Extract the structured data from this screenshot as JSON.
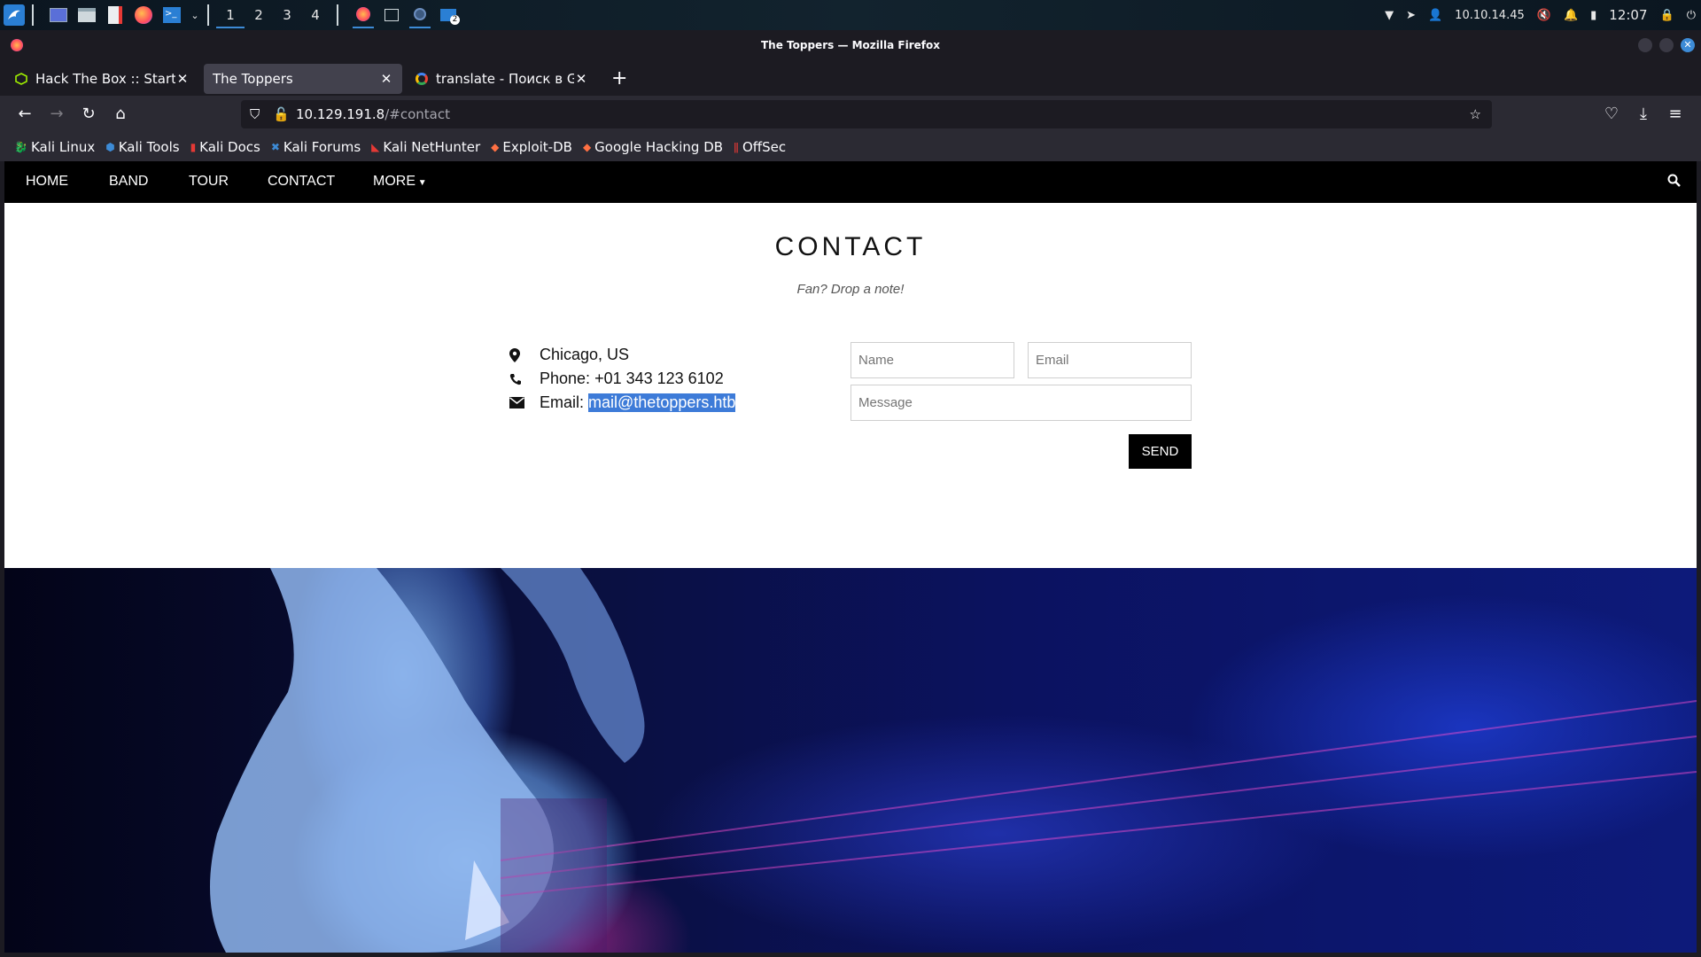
{
  "desktop": {
    "workspaces": [
      "1",
      "2",
      "3",
      "4"
    ],
    "active_workspace": "1",
    "ip": "10.10.14.45",
    "clock": "12:07"
  },
  "window": {
    "title": "The Toppers — Mozilla Firefox"
  },
  "tabs": [
    {
      "label": "Hack The Box :: Starting Point",
      "active": false,
      "icon": "htb-cube-icon"
    },
    {
      "label": "The Toppers",
      "active": true,
      "icon": ""
    },
    {
      "label": "translate - Поиск в Google",
      "active": false,
      "icon": "google-icon"
    }
  ],
  "urlbar": {
    "host": "10.129.191.8",
    "path": "/#contact"
  },
  "bookmarks": [
    {
      "label": "Kali Linux",
      "icon": "kali-dragon-icon"
    },
    {
      "label": "Kali Tools",
      "icon": "kali-tools-icon"
    },
    {
      "label": "Kali Docs",
      "icon": "kali-docs-icon"
    },
    {
      "label": "Kali Forums",
      "icon": "kali-forums-icon"
    },
    {
      "label": "Kali NetHunter",
      "icon": "nethunter-icon"
    },
    {
      "label": "Exploit-DB",
      "icon": "exploit-db-icon"
    },
    {
      "label": "Google Hacking DB",
      "icon": "ghdb-icon"
    },
    {
      "label": "OffSec",
      "icon": "offsec-icon"
    }
  ],
  "site_nav": {
    "items": [
      "HOME",
      "BAND",
      "TOUR",
      "CONTACT"
    ],
    "more": "MORE"
  },
  "contact": {
    "title": "CONTACT",
    "tagline": "Fan? Drop a note!",
    "location": "Chicago, US",
    "phone_label": "Phone: ",
    "phone": "+01 343 123 6102",
    "email_label": "Email: ",
    "email": "mail@thetoppers.htb",
    "form": {
      "name_placeholder": "Name",
      "email_placeholder": "Email",
      "message_placeholder": "Message",
      "send_label": "SEND"
    }
  },
  "colors": {
    "accent": "#3d8bd6",
    "selection": "#3d7bd8",
    "site_nav_bg": "#000000",
    "browser_bg": "#1c1b22"
  }
}
